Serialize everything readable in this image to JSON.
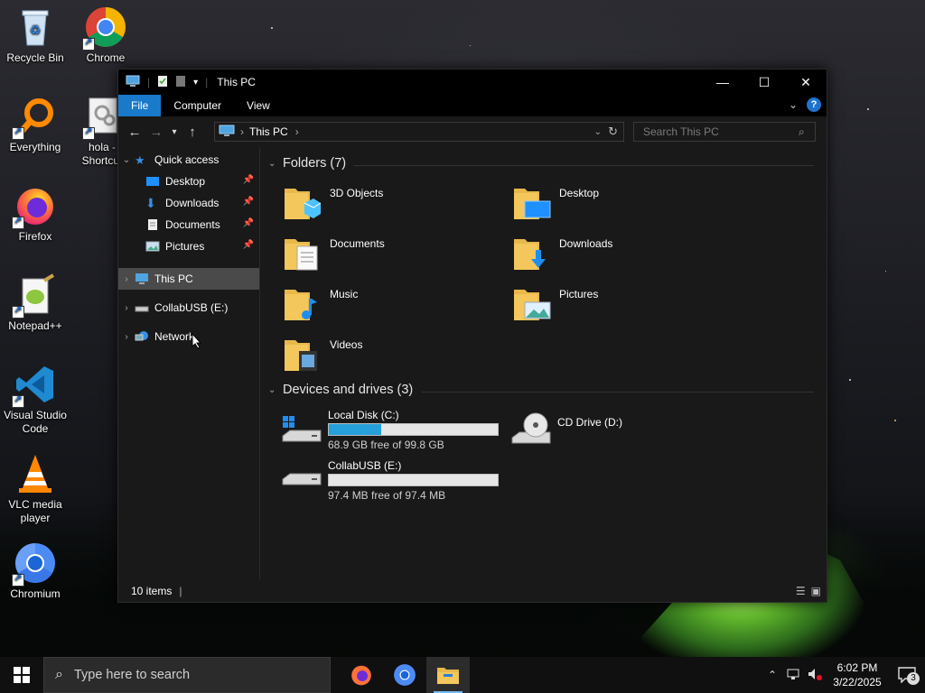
{
  "desktop": {
    "icons": [
      {
        "label": "Recycle Bin",
        "icon": "recycle-bin-icon"
      },
      {
        "label": "Chrome",
        "icon": "chrome-icon"
      },
      {
        "label": "Everything",
        "icon": "everything-search-icon"
      },
      {
        "label": "hola - Shortcut",
        "icon": "shortcut-file-icon"
      },
      {
        "label": "Firefox",
        "icon": "firefox-icon"
      },
      {
        "label": "Notepad++",
        "icon": "notepad-plus-plus-icon"
      },
      {
        "label": "Visual Studio Code",
        "icon": "vscode-icon"
      },
      {
        "label": "VLC media player",
        "icon": "vlc-icon"
      },
      {
        "label": "Chromium",
        "icon": "chromium-icon"
      }
    ]
  },
  "window": {
    "title": "This PC",
    "ribbon_tabs": [
      "File",
      "Computer",
      "View"
    ],
    "address": {
      "segments": [
        "This PC"
      ]
    },
    "search_placeholder": "Search This PC",
    "nav_pane": {
      "quick_access": "Quick access",
      "quick_items": [
        "Desktop",
        "Downloads",
        "Documents",
        "Pictures"
      ],
      "this_pc": "This PC",
      "usb": "CollabUSB (E:)",
      "network": "Network"
    },
    "folders_header": "Folders (7)",
    "folders": [
      "3D Objects",
      "Desktop",
      "Documents",
      "Downloads",
      "Music",
      "Pictures",
      "Videos"
    ],
    "drives_header": "Devices and drives (3)",
    "drives": [
      {
        "name": "Local Disk (C:)",
        "free": "68.9 GB free of 99.8 GB",
        "used_fraction": 0.31
      },
      {
        "name": "CD Drive (D:)"
      },
      {
        "name": "CollabUSB (E:)",
        "free": "97.4 MB free of 97.4 MB",
        "used_fraction": 0.0
      }
    ],
    "status": "10 items"
  },
  "taskbar": {
    "search_placeholder": "Type here to search",
    "time": "6:02 PM",
    "date": "3/22/2025",
    "notifications": "3"
  },
  "colors": {
    "accent": "#1979ca",
    "folder": "#f3c75b",
    "progress": "#26a0da"
  }
}
